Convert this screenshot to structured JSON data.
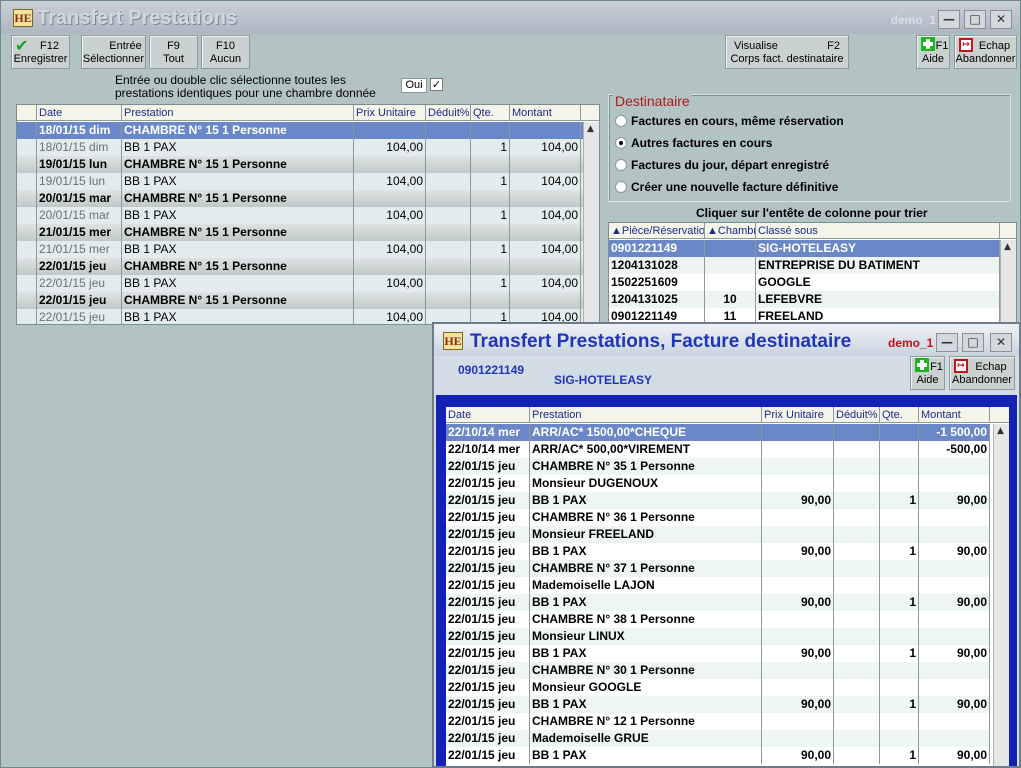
{
  "app": {
    "logo": "HE",
    "title": "Transfert Prestations",
    "user": "demo_1"
  },
  "toolbar": {
    "save": {
      "key": "F12",
      "label": "Enregistrer"
    },
    "select": {
      "key": "Entrée",
      "label": "Sélectionner"
    },
    "all": {
      "key": "F9",
      "label": "Tout"
    },
    "none": {
      "key": "F10",
      "label": "Aucun"
    },
    "visualise": {
      "key": "F2",
      "line1": "Visualise",
      "line2": "Corps fact. destinataire"
    },
    "help": {
      "key": "F1",
      "label": "Aide"
    },
    "cancel": {
      "key": "Echap",
      "label": "Abandonner"
    }
  },
  "info": {
    "line1": "Entrée ou double clic sélectionne toutes les",
    "line2": "prestations identiques pour une chambre donnée",
    "oui": "Oui",
    "checked": "✓"
  },
  "left_grid": {
    "headers": [
      "Date",
      "Prestation",
      "Prix Unitaire",
      "Déduit%",
      "Qte.",
      "Montant"
    ],
    "rows": [
      {
        "date": "18/01/15 dim",
        "prestation": "CHAMBRE N° 15 1 Personne",
        "prix": "",
        "deduit": "",
        "qte": "",
        "montant": ""
      },
      {
        "date": "18/01/15 dim",
        "prestation": "    BB 1 PAX",
        "prix": "104,00",
        "deduit": "",
        "qte": "1",
        "montant": "104,00"
      },
      {
        "date": "19/01/15 lun",
        "prestation": "CHAMBRE N° 15 1 Personne",
        "prix": "",
        "deduit": "",
        "qte": "",
        "montant": ""
      },
      {
        "date": "19/01/15 lun",
        "prestation": "    BB 1 PAX",
        "prix": "104,00",
        "deduit": "",
        "qte": "1",
        "montant": "104,00"
      },
      {
        "date": "20/01/15 mar",
        "prestation": "CHAMBRE N° 15 1 Personne",
        "prix": "",
        "deduit": "",
        "qte": "",
        "montant": ""
      },
      {
        "date": "20/01/15 mar",
        "prestation": "    BB 1 PAX",
        "prix": "104,00",
        "deduit": "",
        "qte": "1",
        "montant": "104,00"
      },
      {
        "date": "21/01/15 mer",
        "prestation": "CHAMBRE N° 15 1 Personne",
        "prix": "",
        "deduit": "",
        "qte": "",
        "montant": ""
      },
      {
        "date": "21/01/15 mer",
        "prestation": "    BB 1 PAX",
        "prix": "104,00",
        "deduit": "",
        "qte": "1",
        "montant": "104,00"
      },
      {
        "date": "22/01/15 jeu",
        "prestation": "CHAMBRE N° 15 1 Personne",
        "prix": "",
        "deduit": "",
        "qte": "",
        "montant": ""
      },
      {
        "date": "22/01/15 jeu",
        "prestation": "    BB 1 PAX",
        "prix": "104,00",
        "deduit": "",
        "qte": "1",
        "montant": "104,00"
      },
      {
        "date": "22/01/15 jeu",
        "prestation": "CHAMBRE N° 15 1 Personne",
        "prix": "",
        "deduit": "",
        "qte": "",
        "montant": ""
      },
      {
        "date": "22/01/15 jeu",
        "prestation": "    BB 1 PAX",
        "prix": "104,00",
        "deduit": "",
        "qte": "1",
        "montant": "104,00"
      }
    ]
  },
  "destinataire": {
    "title": "Destinataire",
    "options": [
      {
        "label": "Factures en cours, même réservation",
        "selected": false
      },
      {
        "label": "Autres factures en cours",
        "selected": true
      },
      {
        "label": "Factures du jour, départ enregistré",
        "selected": false
      },
      {
        "label": "Créer une nouvelle facture définitive",
        "selected": false
      }
    ],
    "sort_hint": "Cliquer sur l'entête de colonne pour trier"
  },
  "invoice_grid": {
    "headers": [
      "Pièce/Réservatio",
      "Chambr",
      "Classé sous"
    ],
    "rows": [
      {
        "piece": "0901221149",
        "chambre": "",
        "classe": "SIG-HOTELEASY"
      },
      {
        "piece": "1204131028",
        "chambre": "",
        "classe": "ENTREPRISE DU BATIMENT"
      },
      {
        "piece": "1502251609",
        "chambre": "",
        "classe": "GOOGLE"
      },
      {
        "piece": "1204131025",
        "chambre": "10",
        "classe": "LEFEBVRE"
      },
      {
        "piece": "0901221149",
        "chambre": "11",
        "classe": "FREELAND"
      }
    ]
  },
  "popup": {
    "title": "Transfert Prestations, Facture destinataire",
    "user": "demo_1",
    "piece": "0901221149",
    "name": "SIG-HOTELEASY",
    "help": {
      "key": "F1",
      "label": "Aide"
    },
    "cancel": {
      "key": "Echap",
      "label": "Abandonner"
    },
    "headers": [
      "Date",
      "Prestation",
      "Prix Unitaire",
      "Déduit%",
      "Qte.",
      "Montant"
    ],
    "rows": [
      {
        "date": "22/10/14 mer",
        "prestation": "ARR/AC* 1500,00*CHEQUE",
        "prix": "",
        "deduit": "",
        "qte": "",
        "montant": "-1 500,00"
      },
      {
        "date": "22/10/14 mer",
        "prestation": "ARR/AC*  500,00*VIREMENT",
        "prix": "",
        "deduit": "",
        "qte": "",
        "montant": "-500,00"
      },
      {
        "date": "22/01/15 jeu",
        "prestation": "CHAMBRE N° 35 1 Personne",
        "prix": "",
        "deduit": "",
        "qte": "",
        "montant": ""
      },
      {
        "date": "22/01/15 jeu",
        "prestation": "Monsieur DUGENOUX",
        "prix": "",
        "deduit": "",
        "qte": "",
        "montant": ""
      },
      {
        "date": "22/01/15 jeu",
        "prestation": "   BB 1 PAX",
        "prix": "90,00",
        "deduit": "",
        "qte": "1",
        "montant": "90,00"
      },
      {
        "date": "22/01/15 jeu",
        "prestation": "CHAMBRE N° 36 1 Personne",
        "prix": "",
        "deduit": "",
        "qte": "",
        "montant": ""
      },
      {
        "date": "22/01/15 jeu",
        "prestation": "Monsieur FREELAND",
        "prix": "",
        "deduit": "",
        "qte": "",
        "montant": ""
      },
      {
        "date": "22/01/15 jeu",
        "prestation": "   BB 1 PAX",
        "prix": "90,00",
        "deduit": "",
        "qte": "1",
        "montant": "90,00"
      },
      {
        "date": "22/01/15 jeu",
        "prestation": "CHAMBRE N° 37 1 Personne",
        "prix": "",
        "deduit": "",
        "qte": "",
        "montant": ""
      },
      {
        "date": "22/01/15 jeu",
        "prestation": "Mademoiselle LAJON",
        "prix": "",
        "deduit": "",
        "qte": "",
        "montant": ""
      },
      {
        "date": "22/01/15 jeu",
        "prestation": "   BB 1 PAX",
        "prix": "90,00",
        "deduit": "",
        "qte": "1",
        "montant": "90,00"
      },
      {
        "date": "22/01/15 jeu",
        "prestation": "CHAMBRE N° 38 1 Personne",
        "prix": "",
        "deduit": "",
        "qte": "",
        "montant": ""
      },
      {
        "date": "22/01/15 jeu",
        "prestation": "Monsieur LINUX",
        "prix": "",
        "deduit": "",
        "qte": "",
        "montant": ""
      },
      {
        "date": "22/01/15 jeu",
        "prestation": "   BB 1 PAX",
        "prix": "90,00",
        "deduit": "",
        "qte": "1",
        "montant": "90,00"
      },
      {
        "date": "22/01/15 jeu",
        "prestation": "CHAMBRE N° 30 1 Personne",
        "prix": "",
        "deduit": "",
        "qte": "",
        "montant": ""
      },
      {
        "date": "22/01/15 jeu",
        "prestation": "Monsieur GOOGLE",
        "prix": "",
        "deduit": "",
        "qte": "",
        "montant": ""
      },
      {
        "date": "22/01/15 jeu",
        "prestation": "   BB 1 PAX",
        "prix": "90,00",
        "deduit": "",
        "qte": "1",
        "montant": "90,00"
      },
      {
        "date": "22/01/15 jeu",
        "prestation": "CHAMBRE N° 12 1 Personne",
        "prix": "",
        "deduit": "",
        "qte": "",
        "montant": ""
      },
      {
        "date": "22/01/15 jeu",
        "prestation": "Mademoiselle GRUE",
        "prix": "",
        "deduit": "",
        "qte": "",
        "montant": ""
      },
      {
        "date": "22/01/15 jeu",
        "prestation": "   BB 1 PAX",
        "prix": "90,00",
        "deduit": "",
        "qte": "1",
        "montant": "90,00"
      }
    ]
  },
  "colors": {
    "selection": "#6a88c8",
    "title_blue": "#1f36b8",
    "red": "#c8101a"
  }
}
